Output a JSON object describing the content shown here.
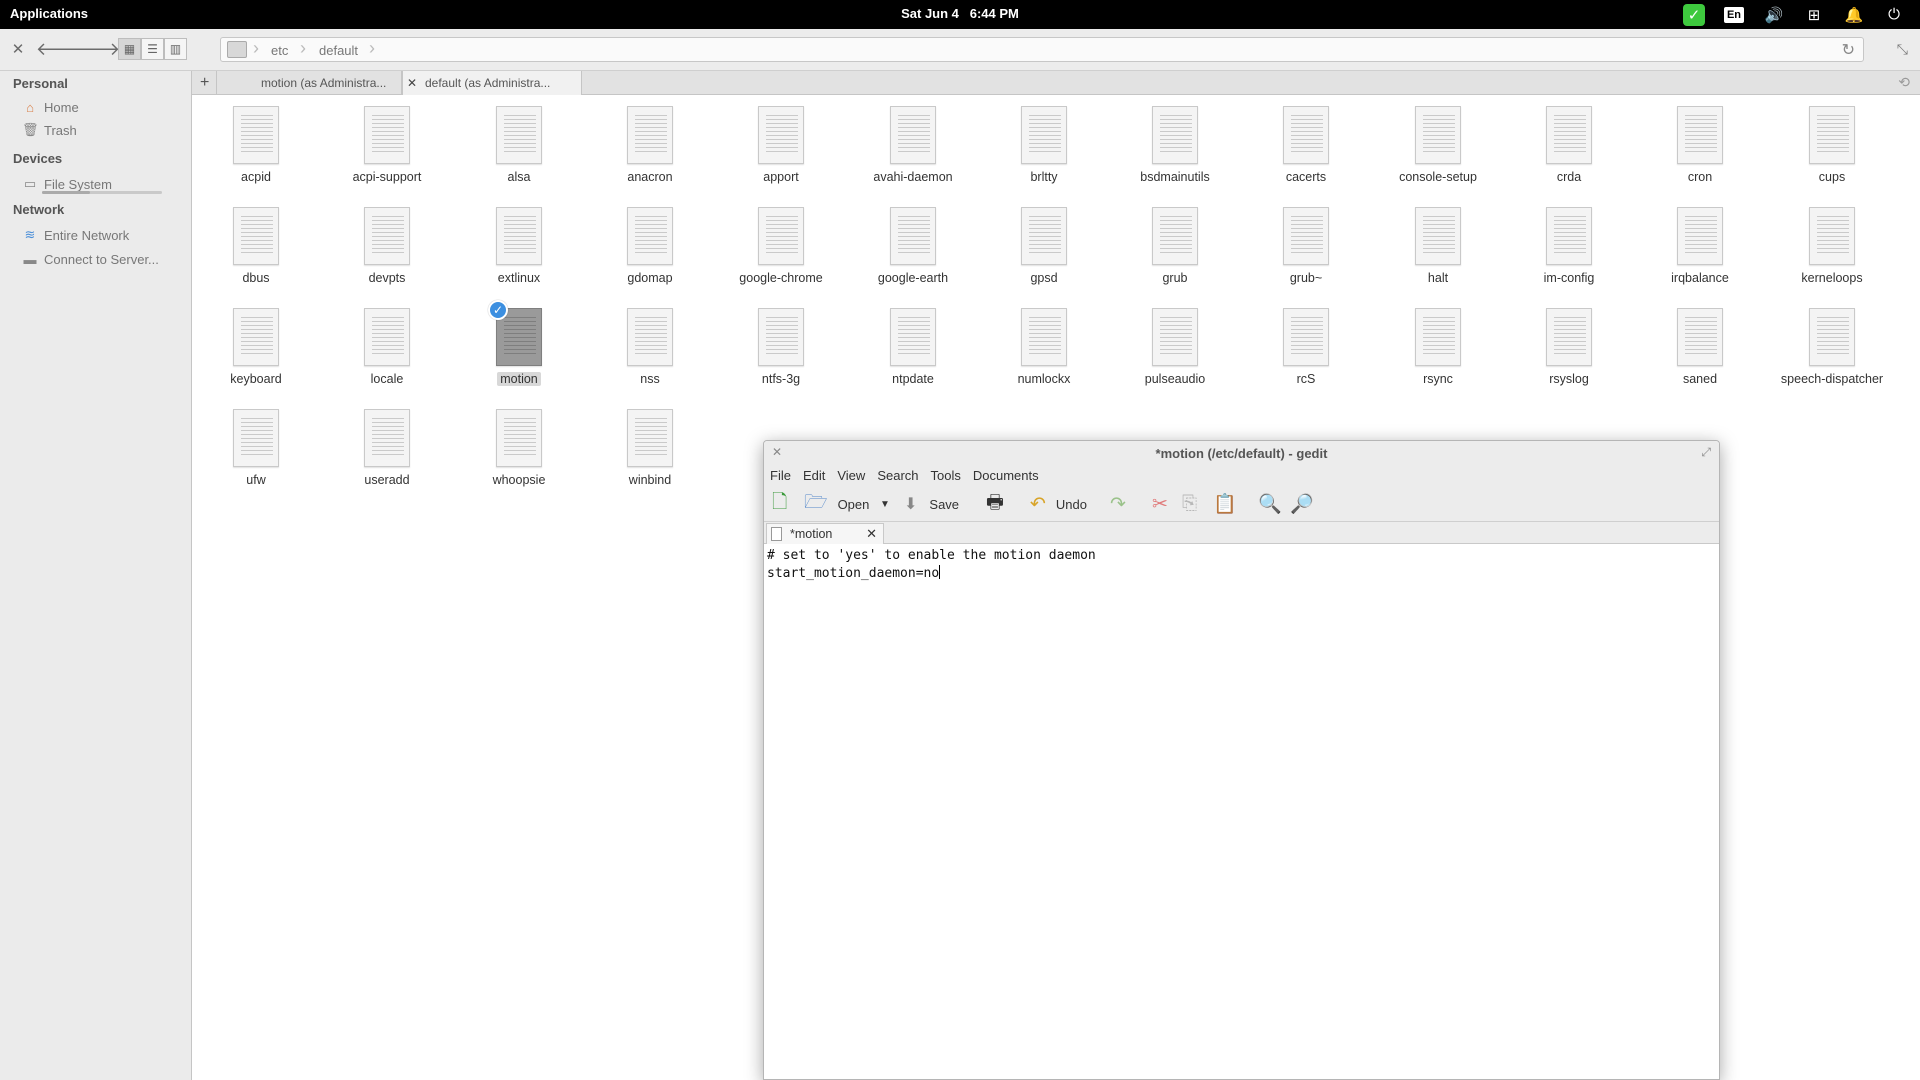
{
  "topbar": {
    "applications": "Applications",
    "date": "Sat Jun  4",
    "time": "6:44 PM",
    "keyboard_layout": "En",
    "icons": [
      "update-check-icon",
      "keyboard-layout-icon",
      "volume-icon",
      "network-icon",
      "notifications-icon",
      "power-icon"
    ]
  },
  "file_manager": {
    "path": [
      "etc",
      "default"
    ],
    "tabs": [
      {
        "label": "motion (as Administra..."
      },
      {
        "label": "default (as Administra..."
      }
    ],
    "sidebar": {
      "sections": [
        {
          "title": "Personal",
          "items": [
            {
              "label": "Home",
              "icon": "home-icon"
            },
            {
              "label": "Trash",
              "icon": "trash-icon"
            }
          ]
        },
        {
          "title": "Devices",
          "items": [
            {
              "label": "File System",
              "icon": "drive-icon"
            }
          ]
        },
        {
          "title": "Network",
          "items": [
            {
              "label": "Entire Network",
              "icon": "wifi-icon"
            },
            {
              "label": "Connect to Server...",
              "icon": "server-icon"
            }
          ]
        }
      ]
    },
    "files": [
      "acpid",
      "acpi-support",
      "alsa",
      "anacron",
      "apport",
      "avahi-daemon",
      "brltty",
      "bsdmainutils",
      "cacerts",
      "console-setup",
      "crda",
      "cron",
      "cups",
      "dbus",
      "devpts",
      "extlinux",
      "gdomap",
      "google-chrome",
      "google-earth",
      "gpsd",
      "grub",
      "grub~",
      "halt",
      "im-config",
      "irqbalance",
      "kerneloops",
      "keyboard",
      "locale",
      "motion",
      "nss",
      "ntfs-3g",
      "ntpdate",
      "numlockx",
      "pulseaudio",
      "rcS",
      "rsync",
      "rsyslog",
      "saned",
      "speech-dispatcher",
      "ufw",
      "useradd",
      "whoopsie",
      "winbind"
    ],
    "selected_file": "motion"
  },
  "gedit": {
    "title": "*motion (/etc/default) - gedit",
    "menu": [
      "File",
      "Edit",
      "View",
      "Search",
      "Tools",
      "Documents"
    ],
    "toolbar": {
      "open": "Open",
      "save": "Save",
      "undo": "Undo"
    },
    "tab_label": "*motion",
    "lines": [
      "# set to 'yes' to enable the motion daemon",
      "start_motion_daemon=no"
    ]
  }
}
